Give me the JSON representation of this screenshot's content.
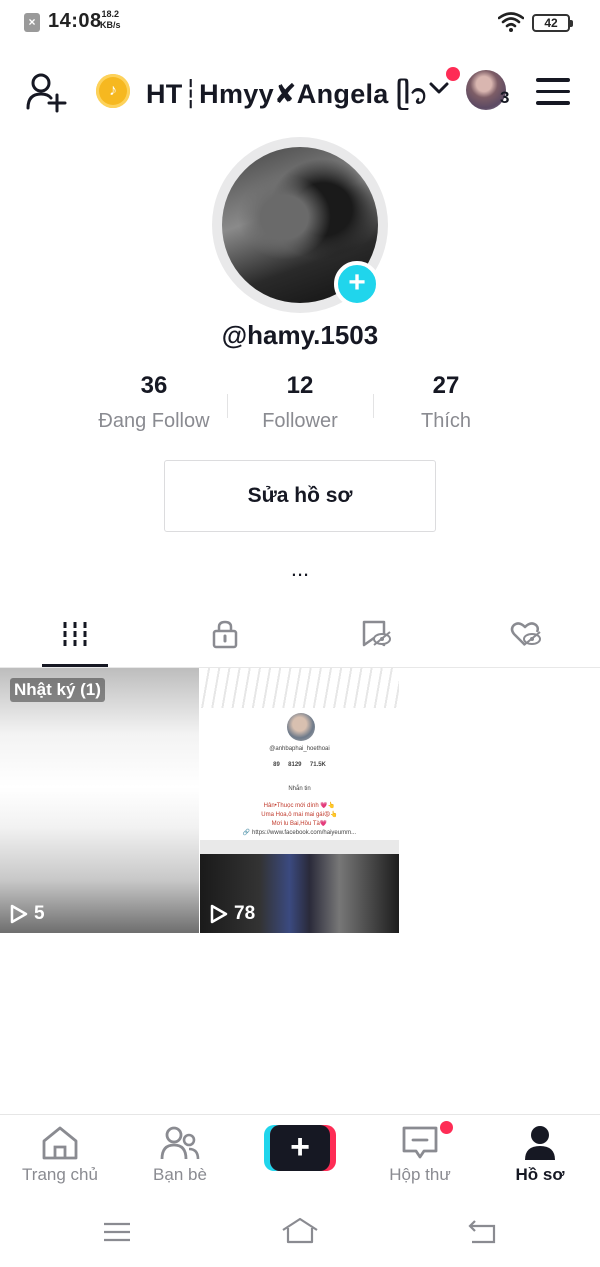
{
  "status_bar": {
    "time": "14:08",
    "speed_value": "18.2",
    "speed_unit": "KB/s",
    "battery": "42"
  },
  "header": {
    "title": "HT┆Hmyy✘Angela ᥫ᭡",
    "account_count": "3"
  },
  "profile": {
    "username": "@hamy.1503",
    "stats": [
      {
        "value": "36",
        "label": "Đang Follow"
      },
      {
        "value": "12",
        "label": "Follower"
      },
      {
        "value": "27",
        "label": "Thích"
      }
    ],
    "edit_button": "Sửa hồ sơ",
    "more": "..."
  },
  "tabs": [
    {
      "icon": "videos-grid-icon",
      "active": true
    },
    {
      "icon": "lock-icon",
      "active": false
    },
    {
      "icon": "hidden-bookmark-icon",
      "active": false
    },
    {
      "icon": "hidden-heart-icon",
      "active": false
    }
  ],
  "videos": [
    {
      "tag": "Nhật ký (1)",
      "views": "5"
    },
    {
      "tag": "",
      "views": "78"
    }
  ],
  "tile2_preview": {
    "handle": "@anhbaphai_hoethoai",
    "stat1": "89",
    "stat2": "8129",
    "stat3": "71.5K",
    "button": "Nhắn tin",
    "line1": "Hân•Thuọc mới dính 💗👆",
    "line2": "Uma Hoa,ô mai mai gái😡👆",
    "line3": "Mơi lu Bai,Hồu Tà💗",
    "link": "🔗 https://www.facebook.com/haiyeumm..."
  },
  "bottom_nav": [
    {
      "label": "Trang chủ",
      "icon": "home-icon"
    },
    {
      "label": "Bạn bè",
      "icon": "friends-icon"
    },
    {
      "label": "",
      "icon": "create-icon"
    },
    {
      "label": "Hộp thư",
      "icon": "inbox-icon"
    },
    {
      "label": "Hồ sơ",
      "icon": "profile-icon"
    }
  ],
  "colors": {
    "accent_cyan": "#20d5ec",
    "accent_red": "#fe2c55",
    "text_primary": "#161823",
    "text_secondary": "#8a8b91"
  }
}
